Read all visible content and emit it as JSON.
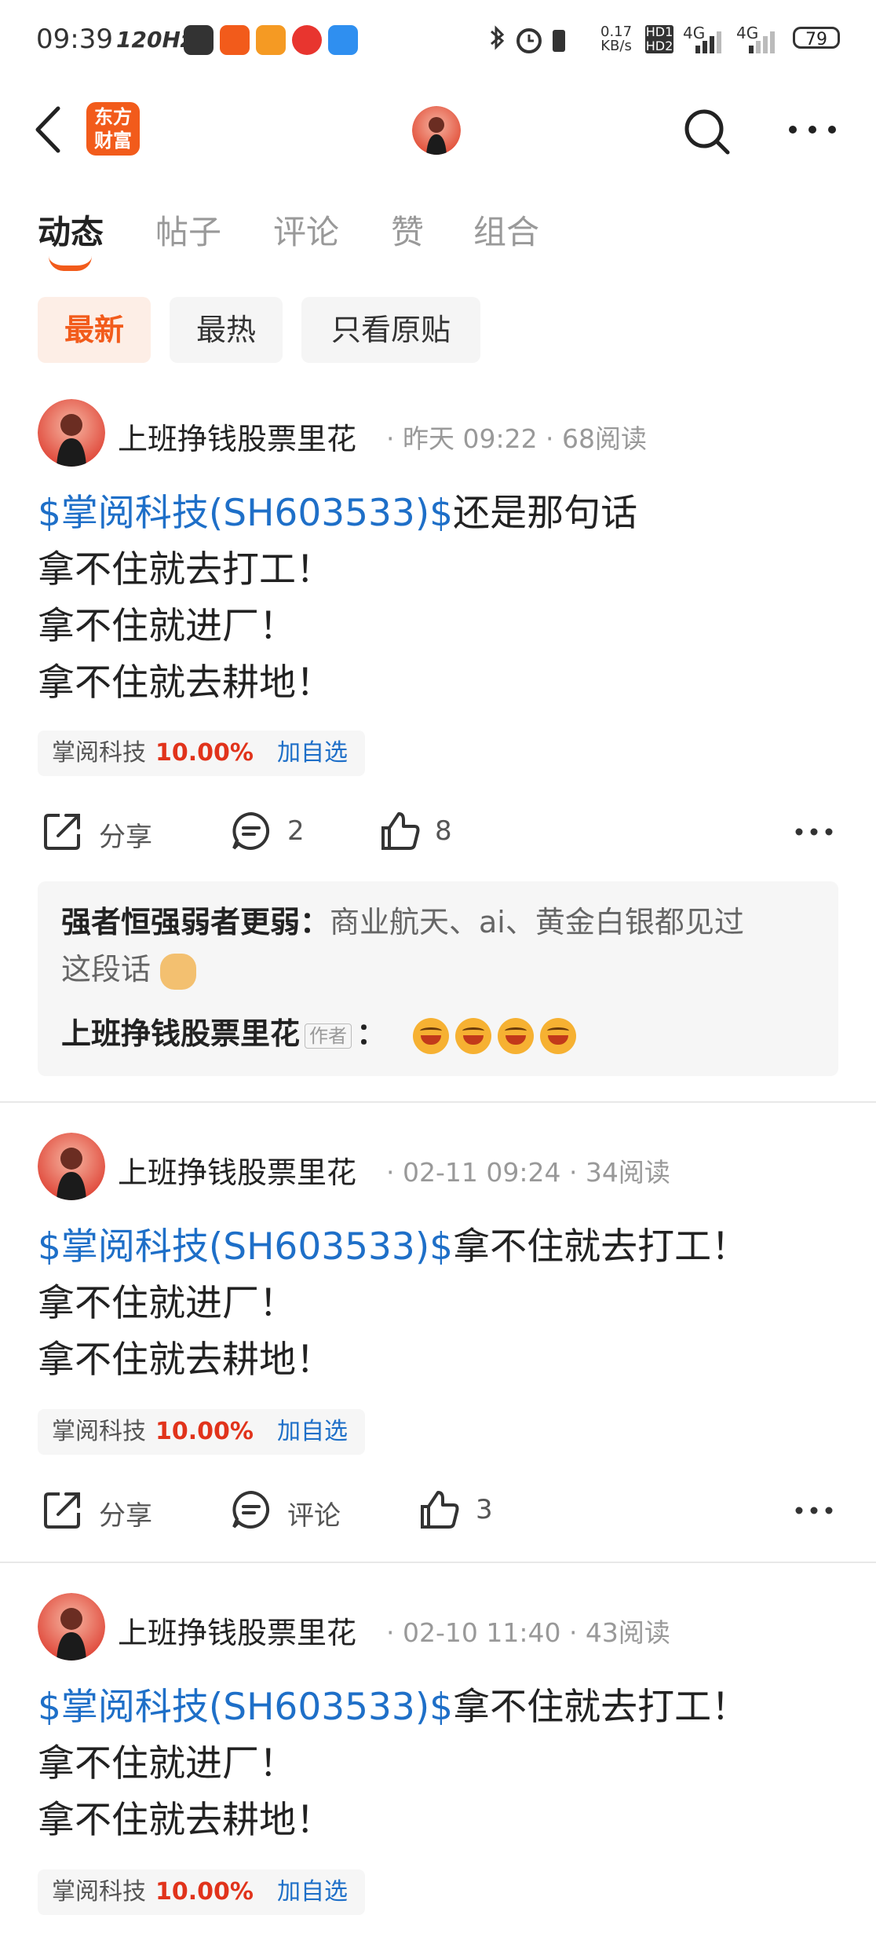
{
  "status_bar": {
    "time": "09:39",
    "refresh": "120Hz",
    "net_speed": "0.17",
    "net_unit": "KB/s",
    "hd": "HD1 HD2",
    "sig1": "4G",
    "sig2": "4G",
    "battery": "79",
    "app_colors": [
      "#333333",
      "#f25b1b",
      "#f59a23",
      "#e8352f",
      "#2f8ff0"
    ]
  },
  "header": {
    "logo_line1": "东方",
    "logo_line2": "财富",
    "brand_color": "#f25b1b"
  },
  "tabs": [
    "动态",
    "帖子",
    "评论",
    "赞",
    "组合"
  ],
  "filters": [
    "最新",
    "最热",
    "只看原贴"
  ],
  "posts": [
    {
      "author": "上班挣钱股票里花",
      "meta": "· 昨天 09:22 · 68阅读",
      "stock_link": "$掌阅科技(SH603533)$",
      "first_line_rest": "还是那句话",
      "lines": [
        "拿不住就去打工！",
        "拿不住就进厂！",
        "拿不住就去耕地！"
      ],
      "tag": {
        "name": "掌阅科技",
        "pct": "10.00%",
        "add": "加自选"
      },
      "actions": {
        "share": "分享",
        "comment": "2",
        "like": "8"
      },
      "comments": [
        {
          "author": "强者恒强弱者更弱：",
          "text": "商业航天、ai、黄金白银都见过",
          "text2": "这段话"
        },
        {
          "author": "上班挣钱股票里花",
          "badge": "作者",
          "sep": "："
        }
      ]
    },
    {
      "author": "上班挣钱股票里花",
      "meta": "· 02-11 09:24 · 34阅读",
      "stock_link": "$掌阅科技(SH603533)$",
      "first_line_rest": "拿不住就去打工！",
      "lines": [
        "拿不住就进厂！",
        "拿不住就去耕地！"
      ],
      "tag": {
        "name": "掌阅科技",
        "pct": "10.00%",
        "add": "加自选"
      },
      "actions": {
        "share": "分享",
        "comment": "评论",
        "like": "3"
      }
    },
    {
      "author": "上班挣钱股票里花",
      "meta": "· 02-10 11:40 · 43阅读",
      "stock_link": "$掌阅科技(SH603533)$",
      "first_line_rest": "拿不住就去打工！",
      "lines": [
        "拿不住就进厂！",
        "拿不住就去耕地！"
      ],
      "tag": {
        "name": "掌阅科技",
        "pct": "10.00%",
        "add": "加自选"
      }
    }
  ]
}
